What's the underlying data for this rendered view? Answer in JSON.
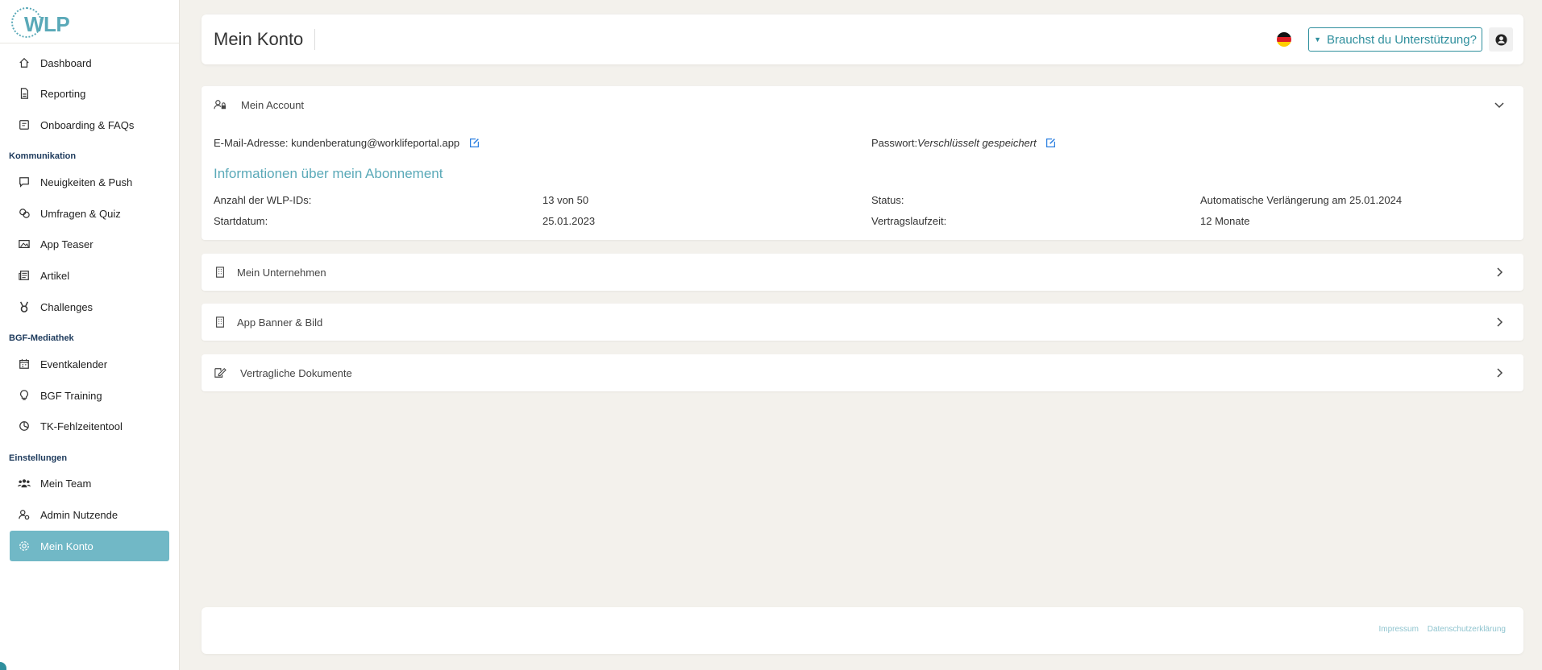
{
  "logo": {
    "text": "WLP"
  },
  "sidebar": {
    "items": [
      {
        "label": "Dashboard",
        "icon": "home-icon"
      },
      {
        "label": "Reporting",
        "icon": "document-icon"
      },
      {
        "label": "Onboarding & FAQs",
        "icon": "book-icon"
      }
    ],
    "sections": [
      {
        "title": "Kommunikation",
        "items": [
          {
            "label": "Neuigkeiten & Push",
            "icon": "message-icon"
          },
          {
            "label": "Umfragen & Quiz",
            "icon": "chat-icon"
          },
          {
            "label": "App Teaser",
            "icon": "image-icon"
          },
          {
            "label": "Artikel",
            "icon": "newspaper-icon"
          },
          {
            "label": "Challenges",
            "icon": "medal-icon"
          }
        ]
      },
      {
        "title": "BGF-Mediathek",
        "items": [
          {
            "label": "Eventkalender",
            "icon": "calendar-icon"
          },
          {
            "label": "BGF Training",
            "icon": "lightbulb-icon"
          },
          {
            "label": "TK-Fehlzeitentool",
            "icon": "pie-chart-icon"
          }
        ]
      },
      {
        "title": "Einstellungen",
        "items": [
          {
            "label": "Mein Team",
            "icon": "team-icon"
          },
          {
            "label": "Admin Nutzende",
            "icon": "user-gear-icon"
          },
          {
            "label": "Mein Konto",
            "icon": "gear-icon",
            "active": true
          }
        ]
      }
    ],
    "active_color": "#71b8c6"
  },
  "header": {
    "title": "Mein Konto",
    "language_flag": "flag-de-icon",
    "support_label": "Brauchst du Unterstützung?",
    "user_icon": "user-circle-icon"
  },
  "account": {
    "title": "Mein Account",
    "email_label": "E-Mail-Adresse:",
    "email_value": "kundenberatung@worklifeportal.app",
    "password_label": "Passwort:",
    "password_value": "Verschlüsselt gespeichert",
    "subscription_title": "Informationen über mein Abonnement",
    "rows": [
      {
        "label": "Anzahl der WLP-IDs:",
        "value": "13 von 50"
      },
      {
        "label": "Startdatum:",
        "value": "25.01.2023"
      },
      {
        "label": "Status:",
        "value": "Automatische Verlängerung am 25.01.2024"
      },
      {
        "label": "Vertragslaufzeit:",
        "value": "12 Monate"
      }
    ]
  },
  "panels": [
    {
      "title": "Mein Unternehmen",
      "icon": "building-icon"
    },
    {
      "title": "App Banner & Bild",
      "icon": "building-icon"
    },
    {
      "title": "Vertragliche Dokumente",
      "icon": "signature-icon"
    }
  ],
  "footer": {
    "impressum": "Impressum",
    "datenschutz": "Datenschutzerklärung"
  },
  "colors": {
    "accent": "#5aa9b8",
    "button": "#2f8f9d",
    "background": "#f3f1ec"
  }
}
